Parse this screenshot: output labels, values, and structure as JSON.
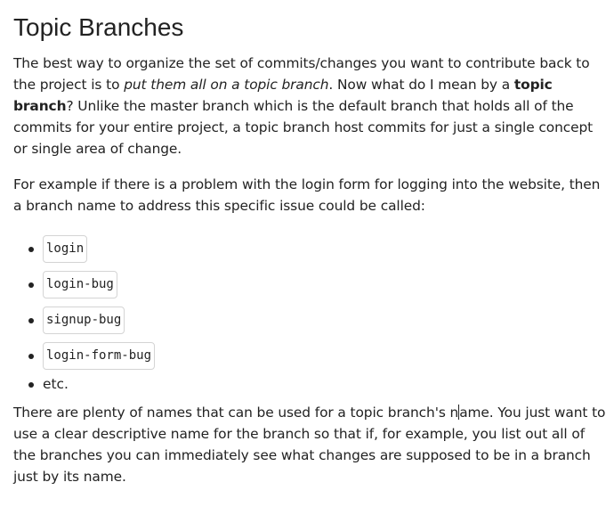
{
  "title": "Topic Branches",
  "para1": {
    "text_a": "The best way to organize the set of commits/changes you want to contribute back to the project is to ",
    "emphasis": "put them all on a topic branch",
    "text_b": ". Now what do I mean by a ",
    "strong": "topic branch",
    "text_c": "? Unlike the master branch which is the default branch that holds all of the commits for your entire project, a topic branch host commits for just a single concept or single area of change."
  },
  "para2": "For example if there is a problem with the login form for logging into the website, then a branch name to address this specific issue could be called:",
  "branch_names": [
    "login",
    "login-bug",
    "signup-bug",
    "login-form-bug"
  ],
  "etc": "etc.",
  "para3": {
    "text_a": "There are plenty of names that can be used for a topic branch's n",
    "text_b": "ame. You just want to use a clear descriptive name for the branch so that if, for example, you list out all of the branches you can immediately see what changes are supposed to be in a branch just by its name."
  }
}
